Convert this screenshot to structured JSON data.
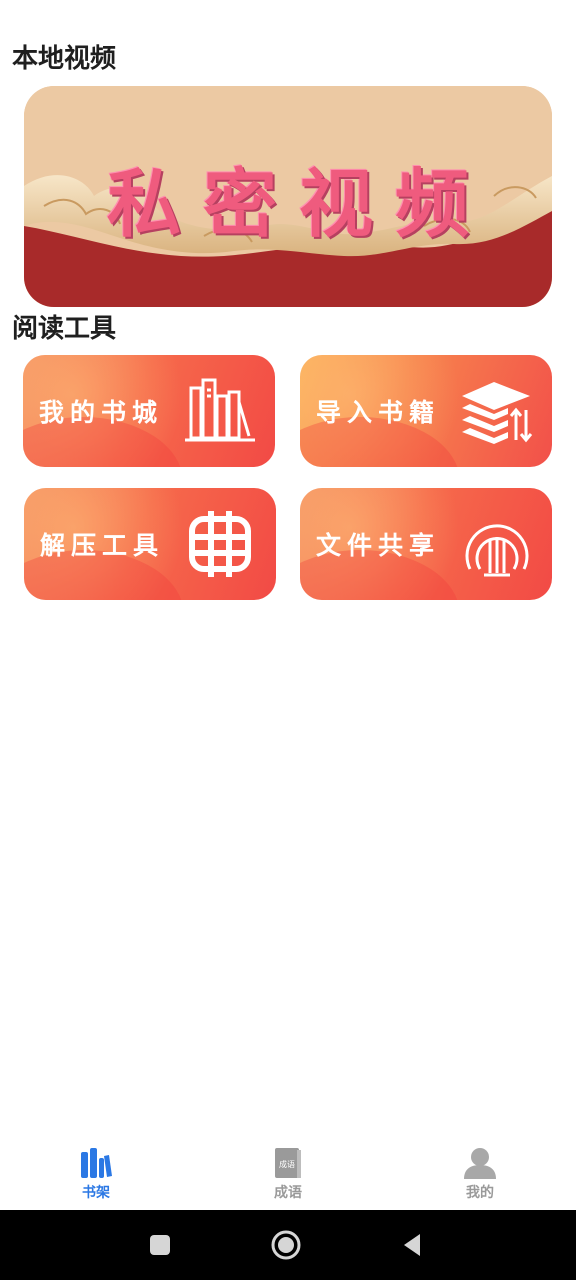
{
  "sections": {
    "local_video": "本地视频",
    "reading_tools": "阅读工具"
  },
  "banner": {
    "text": "私密视频"
  },
  "tiles": [
    {
      "label": "我的书城",
      "icon": "bookshelf-icon"
    },
    {
      "label": "导入书籍",
      "icon": "import-books-icon"
    },
    {
      "label": "解压工具",
      "icon": "unzip-grid-icon"
    },
    {
      "label": "文件共享",
      "icon": "share-signal-icon"
    }
  ],
  "tabbar": {
    "tabs": [
      {
        "label": "书架",
        "icon": "books-icon",
        "active": true,
        "color": "#2b78e4"
      },
      {
        "label": "成语",
        "icon": "idiom-book-icon",
        "active": false,
        "color": "#9a9a9a"
      },
      {
        "label": "我的",
        "icon": "user-icon",
        "active": false,
        "color": "#9a9a9a"
      }
    ],
    "idiom_icon_text": "成语"
  },
  "system_nav": {
    "buttons": [
      "recent-apps-icon",
      "home-icon",
      "back-icon"
    ]
  }
}
